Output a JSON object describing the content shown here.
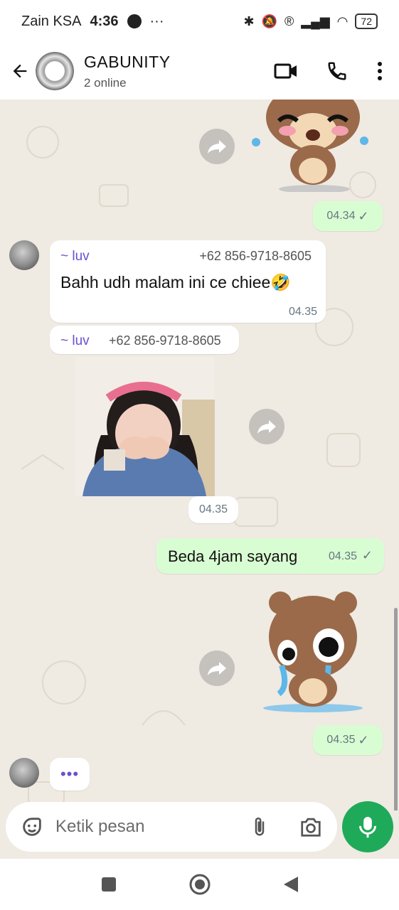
{
  "status": {
    "carrier": "Zain KSA",
    "time": "4:36",
    "battery": "72"
  },
  "header": {
    "title": "GABUNITY",
    "subtitle": "2 online"
  },
  "messages": {
    "sticker1_time": "04.34",
    "msg1": {
      "sender": "~ luv",
      "phone": "+62 856-9718-8605",
      "text": "Bahh udh malam ini ce chiee🤣",
      "time": "04.35"
    },
    "msg2": {
      "sender": "~ luv",
      "phone": "+62 856-9718-8605",
      "time": "04.35"
    },
    "msg3": {
      "text": "Beda 4jam sayang",
      "time": "04.35"
    },
    "sticker2_time": "04.35",
    "typing": "•••"
  },
  "input": {
    "placeholder": "Ketik pesan"
  },
  "colors": {
    "accent": "#1faa59",
    "outgoing_bubble": "#d9fdd3",
    "sender_name": "#6b4fcf",
    "chat_background": "#efeae2"
  }
}
